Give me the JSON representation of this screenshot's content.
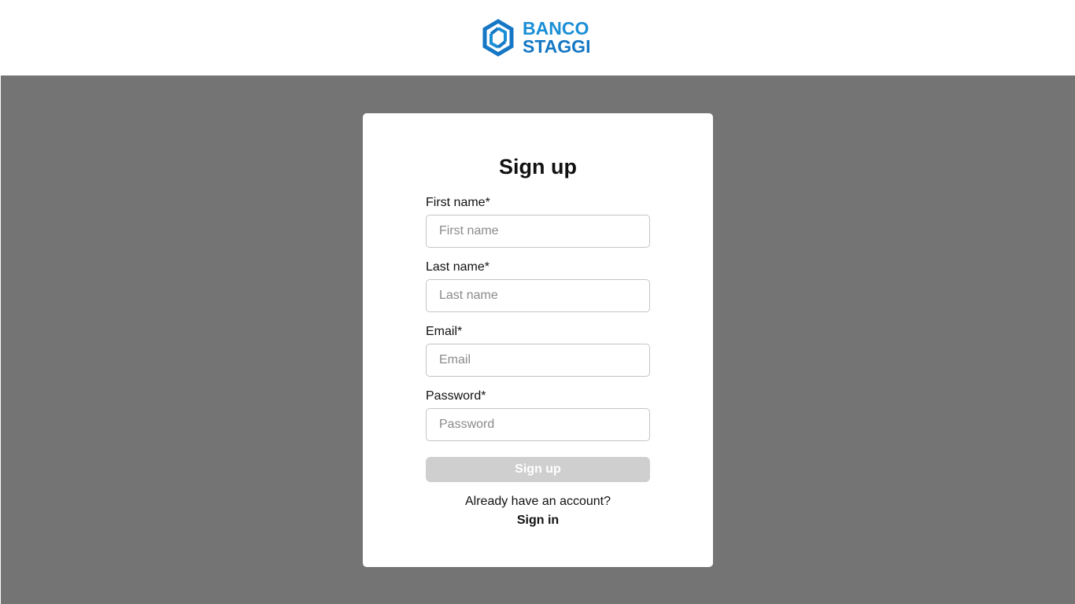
{
  "brand": {
    "line1": "BANCO",
    "line2": "STAGGI",
    "icon": "hexagon-swirl-logo-icon",
    "colors": {
      "primary": "#1a8fd6",
      "dark": "#1677c4"
    }
  },
  "form": {
    "title": "Sign up",
    "fields": [
      {
        "label": "First name*",
        "placeholder": "First name"
      },
      {
        "label": "Last name*",
        "placeholder": "Last name"
      },
      {
        "label": "Email*",
        "placeholder": "Email"
      },
      {
        "label": "Password*",
        "placeholder": "Password"
      }
    ],
    "submit_label": "Sign up",
    "account_prompt": "Already have an account?",
    "signin_label": "Sign in"
  },
  "colors": {
    "backdrop": "#747474",
    "card": "#ffffff",
    "button_disabled": "#cfcfcf"
  }
}
